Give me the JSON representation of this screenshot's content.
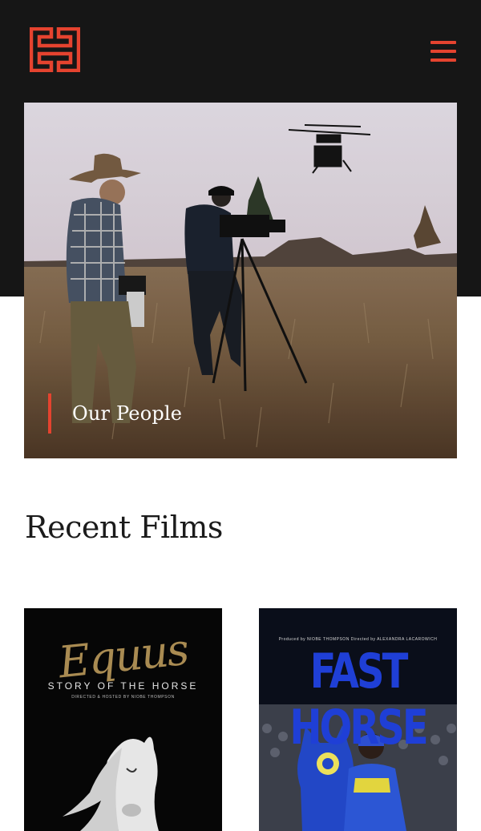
{
  "header": {
    "logo_icon": "hh-monogram-logo",
    "menu_icon": "hamburger-menu-icon",
    "accent_color": "#e5432f",
    "background_color": "#161616"
  },
  "hero": {
    "label": "Our People",
    "image": "cowboy and camera operator filming in grassland with a drone overhead"
  },
  "recent_films": {
    "heading": "Recent Films",
    "films": [
      {
        "poster_title": "Equus",
        "poster_subtitle": "STORY OF THE HORSE",
        "poster_credit": "DIRECTED & HOSTED BY NIOBE THOMPSON"
      },
      {
        "poster_credit": "Produced by NIOBE THOMPSON  Directed by ALEXANDRA LACAROWICH",
        "poster_title": "FAST HORSE"
      }
    ]
  }
}
